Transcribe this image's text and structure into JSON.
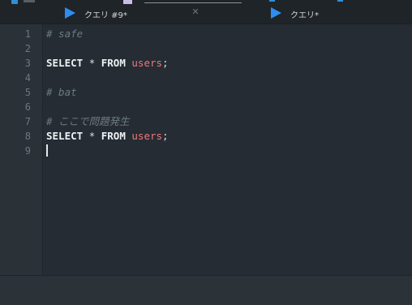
{
  "tabs": [
    {
      "label": "クエリ #9*",
      "icon": "play-icon",
      "close_icon": "close-icon",
      "close_glyph": "✕"
    },
    {
      "label": "クエリ*",
      "icon": "play-icon"
    }
  ],
  "editor": {
    "line_numbers": [
      "1",
      "2",
      "3",
      "4",
      "5",
      "6",
      "7",
      "8",
      "9"
    ],
    "lines": [
      {
        "comment": "# safe"
      },
      {},
      {
        "kw1": "SELECT",
        "op": "*",
        "kw2": "FROM",
        "ident": "users",
        "semi": ";"
      },
      {},
      {
        "comment": "# bat"
      },
      {},
      {
        "comment": "# ここで問題発生"
      },
      {
        "kw1": "SELECT",
        "op": "*",
        "kw2": "FROM",
        "ident": "users",
        "semi": ";"
      },
      {
        "caret": true
      }
    ]
  },
  "colors": {
    "background": "#252c33",
    "gutter": "#2a3238",
    "tab_icon": "#2d8ef0",
    "keyword": "#eef2f5",
    "identifier": "#f0767b",
    "comment": "#6d7a84"
  }
}
